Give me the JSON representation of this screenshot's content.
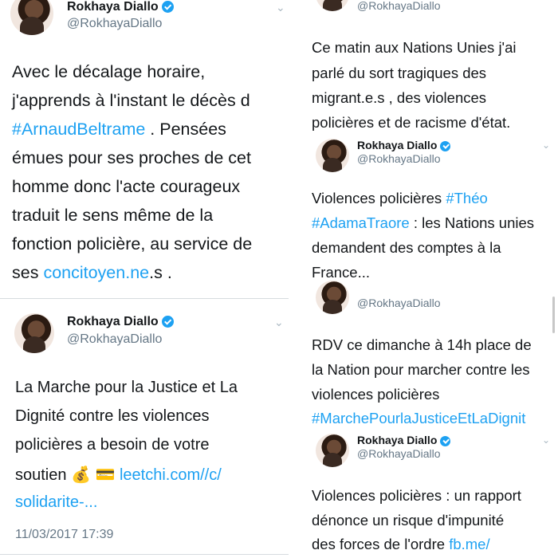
{
  "tweets": {
    "t1": {
      "name": "Rokhaya Diallo",
      "handle": "@RokhayaDiallo",
      "l1": "Avec le décalage horaire,",
      "l2": "j'apprends à l'instant le décès d",
      "l3_link": "#ArnaudBeltrame",
      "l3_rest": " . Pensées",
      "l4": "émues pour ses proches de cet",
      "l5": "homme donc l'acte courageux",
      "l6": "traduit le sens même de la",
      "l7": "fonction policière, au service de",
      "l8_pre": "ses ",
      "l8_link": "concitoyen.ne",
      "l8_post": ".s ."
    },
    "t2": {
      "name": "Rokhaya Diallo",
      "handle": "@RokhayaDiallo",
      "l1": "La Marche pour la Justice et La",
      "l2": "Dignité contre les violences",
      "l3": "policières a besoin de votre",
      "l4_pre": "soutien 💰 💳 ",
      "l4_link": "leetchi.com//c/",
      "l5_link": "solidarite-...",
      "time": "11/03/2017 17:39"
    },
    "t3": {
      "handle": "@RokhayaDiallo",
      "l1": "Ce matin aux Nations Unies j'ai",
      "l2": "parlé du sort tragiques des",
      "l3": "migrant.e.s , des violences",
      "l4": "policières et de racisme d'état."
    },
    "t4": {
      "name": "Rokhaya Diallo",
      "handle": "@RokhayaDiallo",
      "l1_pre": "Violences policières  ",
      "l1_link": "#Théo",
      "l2_link": "#AdamaTraore",
      "l2_rest": " : les Nations unies",
      "l3": "demandent des comptes à la",
      "l4": "France..."
    },
    "t5": {
      "handle": "@RokhayaDiallo",
      "l1": "RDV ce dimanche à 14h place de",
      "l2": "la Nation pour marcher contre les",
      "l3": "violences policières",
      "l4_link": "#MarchePourlaJusticeEtLaDignit"
    },
    "t6": {
      "name": "Rokhaya Diallo",
      "handle": "@RokhayaDiallo",
      "l1": "Violences policières : un rapport",
      "l2": "dénonce un risque d'impunité",
      "l3_pre": "des forces de l'ordre ",
      "l3_link": "fb.me/"
    }
  },
  "icons": {
    "verified": "verified-badge-icon",
    "menu": "chevron-down-icon"
  },
  "colors": {
    "link": "#1da1f2",
    "secondary_text": "#657786",
    "verified": "#1da1f2"
  }
}
